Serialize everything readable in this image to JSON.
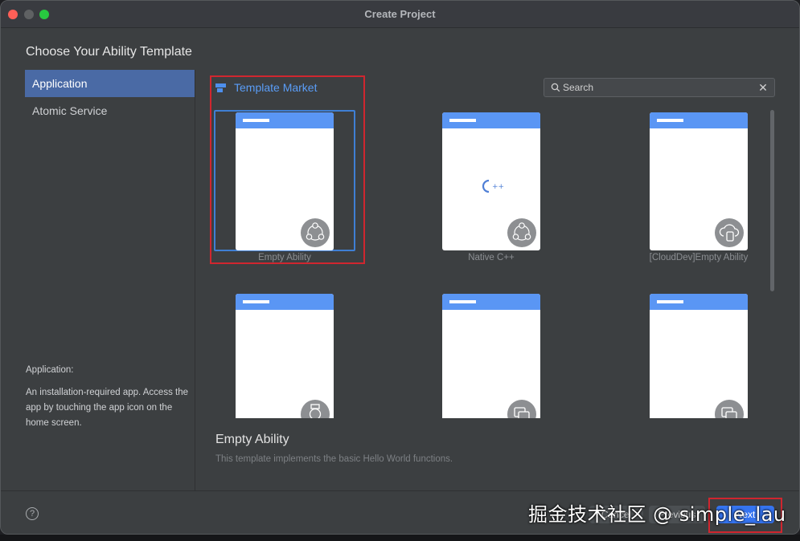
{
  "window": {
    "title": "Create Project"
  },
  "heading": "Choose Your Ability Template",
  "sidebar": {
    "items": [
      {
        "label": "Application",
        "active": true
      },
      {
        "label": "Atomic Service",
        "active": false
      }
    ],
    "description_title": "Application:",
    "description": "An installation-required app. Access the app by touching the app icon on the home screen."
  },
  "market": {
    "label": "Template Market",
    "icon": "template-market-icon"
  },
  "search": {
    "placeholder": "Search",
    "value": ""
  },
  "templates": [
    {
      "label": "Empty Ability",
      "icon": "ability-nodes-icon",
      "selected": true
    },
    {
      "label": "Native C++",
      "icon": "ability-nodes-icon",
      "center_icon": "cpp-logo-icon",
      "selected": false
    },
    {
      "label": "[CloudDev]Empty Ability",
      "icon": "cloud-device-icon",
      "selected": false
    },
    {
      "label": "",
      "icon": "watch-icon",
      "selected": false
    },
    {
      "label": "",
      "icon": "card-icon",
      "selected": false
    },
    {
      "label": "",
      "icon": "card-icon",
      "selected": false
    }
  ],
  "detail": {
    "title": "Empty Ability",
    "description": "This template implements the basic Hello World functions."
  },
  "footer": {
    "help": "?",
    "cancel": "Cancel",
    "previous": "Previous",
    "next": "Next"
  },
  "watermark": "掘金技术社区 @ simple_lau",
  "colors": {
    "accent": "#3574f0",
    "sidebar_active": "#4a6aa5",
    "link": "#5a9df7",
    "highlight_box": "#d0262f"
  }
}
